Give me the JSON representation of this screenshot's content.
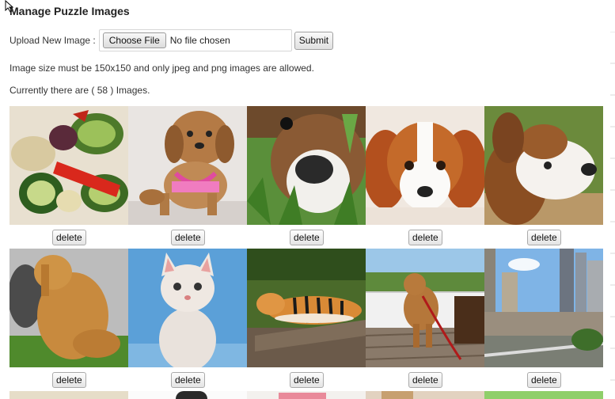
{
  "page": {
    "title": "Manage Puzzle Images"
  },
  "upload": {
    "label": "Upload New Image :",
    "choose_button": "Choose File",
    "file_status": "No file chosen",
    "submit_button": "Submit"
  },
  "notes": {
    "size_rule": "Image size must be 150x150 and only jpeg and png images are allowed.",
    "count_text": "Currently there are ( 58 ) Images."
  },
  "images": [
    {
      "subject": "grilled-vegetables",
      "delete_label": "delete"
    },
    {
      "subject": "dog-in-pink-harness",
      "delete_label": "delete"
    },
    {
      "subject": "boxer-puppy-in-grass",
      "delete_label": "delete"
    },
    {
      "subject": "spaniel-puppy",
      "delete_label": "delete"
    },
    {
      "subject": "puppy-looking-up",
      "delete_label": "delete"
    },
    {
      "subject": "fluffy-dog-standing",
      "delete_label": "delete"
    },
    {
      "subject": "white-kitten",
      "delete_label": "delete"
    },
    {
      "subject": "tiger-resting",
      "delete_label": "delete"
    },
    {
      "subject": "dog-on-deck",
      "delete_label": "delete"
    },
    {
      "subject": "city-skyline",
      "delete_label": "delete"
    }
  ]
}
